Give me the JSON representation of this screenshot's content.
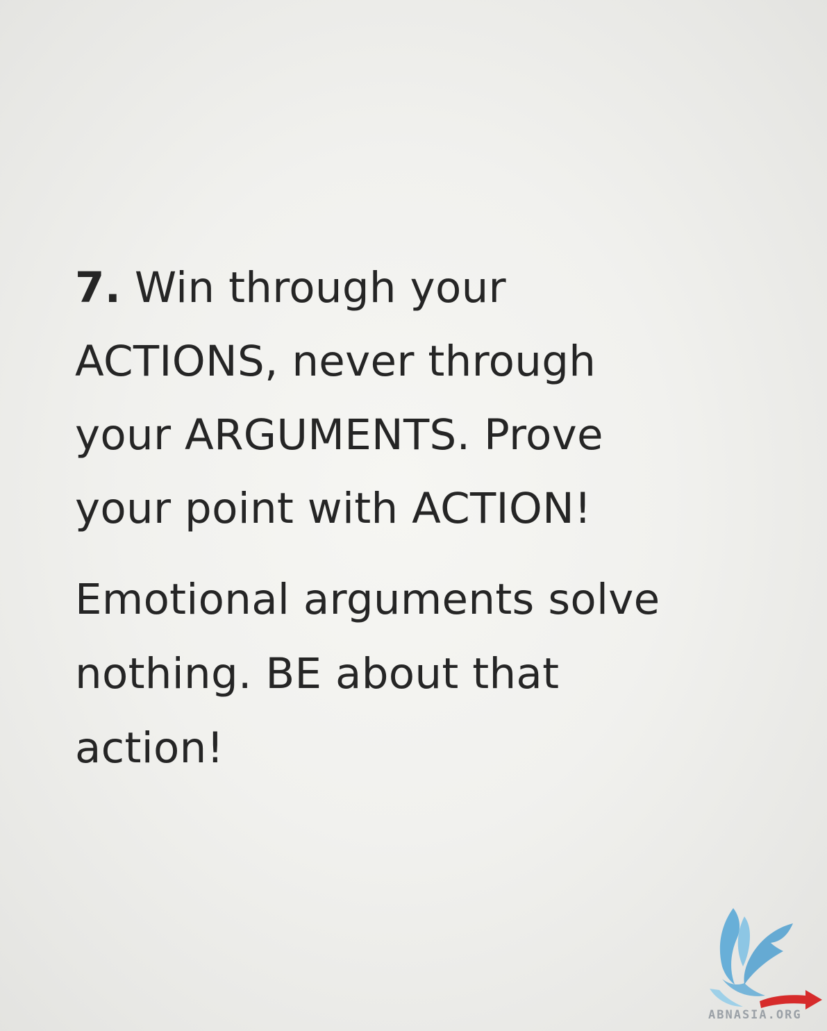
{
  "point": {
    "number": "7.",
    "heading_lines": [
      " Win through your",
      "ACTIONS, never through",
      "your ARGUMENTS. Prove",
      "your point with ACTION!"
    ],
    "body_lines": [
      "Emotional arguments solve",
      "nothing. BE about that",
      "action!"
    ]
  },
  "watermark": {
    "text": "ABNASIA.ORG",
    "icon": "bird-logo-icon",
    "colors": {
      "bird": "#5aa9d6",
      "arrow": "#d62b2b",
      "text": "#9aa0a6"
    }
  }
}
